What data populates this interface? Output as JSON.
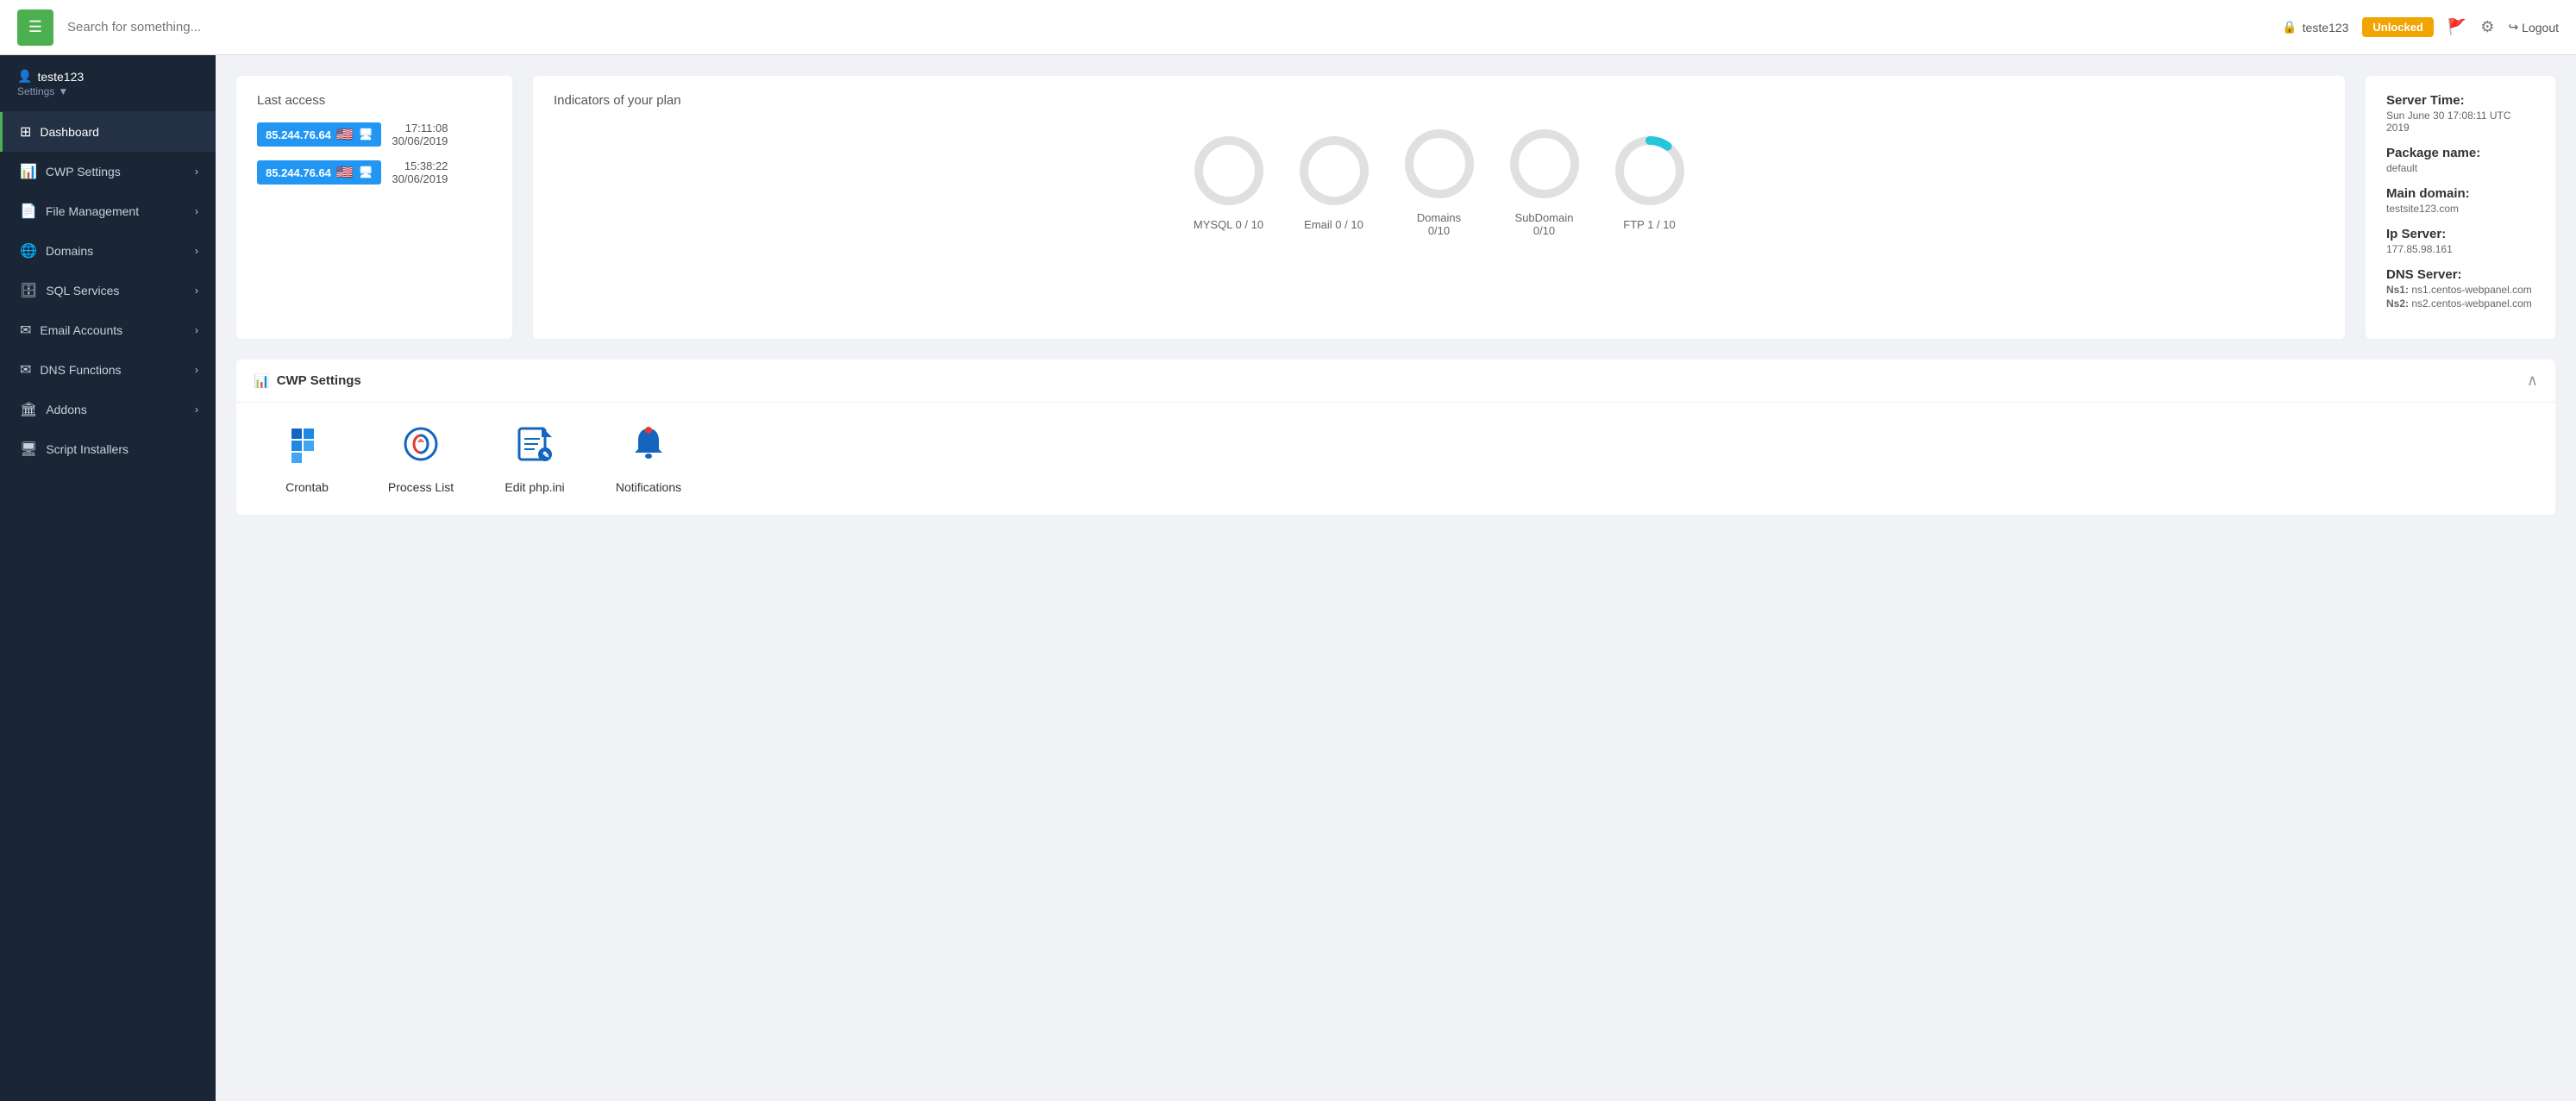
{
  "header": {
    "toggle_label": "≡",
    "search_placeholder": "Search for something...",
    "username": "teste123",
    "unlocked_label": "Unlocked",
    "logout_label": "Logout"
  },
  "sidebar": {
    "username": "teste123",
    "settings_label": "Settings",
    "items": [
      {
        "id": "dashboard",
        "label": "Dashboard",
        "icon": "⊞",
        "active": true,
        "has_arrow": false
      },
      {
        "id": "cwp-settings",
        "label": "CWP Settings",
        "icon": "📊",
        "active": false,
        "has_arrow": true
      },
      {
        "id": "file-management",
        "label": "File Management",
        "icon": "📄",
        "active": false,
        "has_arrow": true
      },
      {
        "id": "domains",
        "label": "Domains",
        "icon": "🌐",
        "active": false,
        "has_arrow": true
      },
      {
        "id": "sql-services",
        "label": "SQL Services",
        "icon": "🗄",
        "active": false,
        "has_arrow": true
      },
      {
        "id": "email-accounts",
        "label": "Email Accounts",
        "icon": "✉",
        "active": false,
        "has_arrow": true
      },
      {
        "id": "dns-functions",
        "label": "DNS Functions",
        "icon": "✉",
        "active": false,
        "has_arrow": true
      },
      {
        "id": "addons",
        "label": "Addons",
        "icon": "🏛",
        "active": false,
        "has_arrow": true
      },
      {
        "id": "script-installers",
        "label": "Script Installers",
        "icon": "🖥",
        "active": false,
        "has_arrow": false
      }
    ]
  },
  "last_access": {
    "title": "Last access",
    "entries": [
      {
        "ip": "85.244.76.64",
        "time": "17:11:08",
        "date": "30/06/2019"
      },
      {
        "ip": "85.244.76.64",
        "time": "15:38:22",
        "date": "30/06/2019"
      }
    ]
  },
  "indicators": {
    "title": "Indicators of your plan",
    "items": [
      {
        "id": "mysql",
        "label": "MYSQL 0 / 10",
        "used": 0,
        "total": 10,
        "color": "#e0e0e0"
      },
      {
        "id": "email",
        "label": "Email 0 / 10",
        "used": 0,
        "total": 10,
        "color": "#e0e0e0"
      },
      {
        "id": "domains",
        "label": "Domains\n0/10",
        "used": 0,
        "total": 10,
        "color": "#e0e0e0"
      },
      {
        "id": "subdomain",
        "label": "SubDomain\n0/10",
        "used": 0,
        "total": 10,
        "color": "#e0e0e0"
      },
      {
        "id": "ftp",
        "label": "FTP 1 / 10",
        "used": 1,
        "total": 10,
        "color": "#26c6da"
      }
    ]
  },
  "server_info": {
    "time_label": "Server Time:",
    "time_value": "Sun June 30 17:08:11 UTC 2019",
    "package_label": "Package name:",
    "package_value": "default",
    "domain_label": "Main domain:",
    "domain_value": "testsite123.com",
    "ip_label": "Ip Server:",
    "ip_value": "177.85.98.161",
    "dns_label": "DNS Server:",
    "dns_ns1_label": "Ns1:",
    "dns_ns1_value": "ns1.centos-webpanel.com",
    "dns_ns2_label": "Ns2:",
    "dns_ns2_value": "ns2.centos-webpanel.com"
  },
  "cwp_settings": {
    "title": "CWP Settings",
    "tools": [
      {
        "id": "crontab",
        "label": "Crontab",
        "icon": "⚙"
      },
      {
        "id": "process-list",
        "label": "Process List",
        "icon": "🔥"
      },
      {
        "id": "edit-phpini",
        "label": "Edit php.ini",
        "icon": "📝"
      },
      {
        "id": "notifications",
        "label": "Notifications",
        "icon": "🔔"
      }
    ]
  }
}
